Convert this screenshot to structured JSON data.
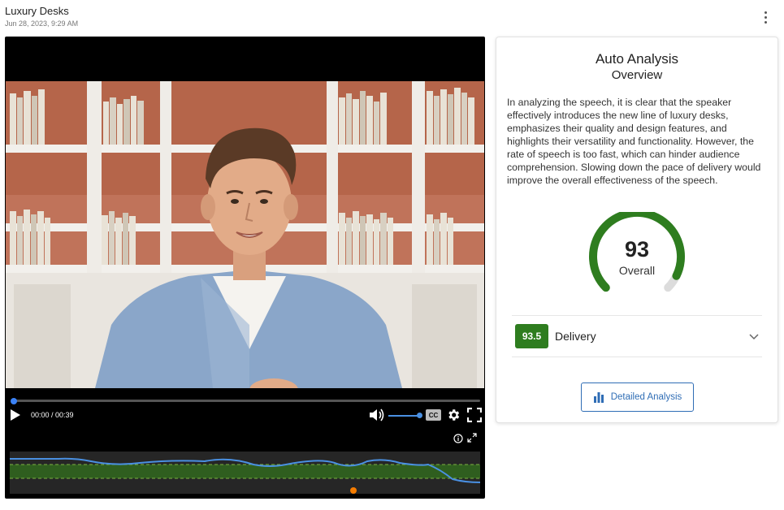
{
  "header": {
    "title": "Luxury Desks",
    "date": "Jun 28, 2023, 9:29 AM",
    "menu_icon": "more-vert-icon"
  },
  "player": {
    "time_display": "00:00 / 00:39",
    "progress": 0.0,
    "volume": 1.0,
    "cc_label": "CC",
    "icons": [
      "play-icon",
      "volume-icon",
      "cc-icon",
      "gear-icon",
      "fullscreen-icon",
      "info-icon",
      "expand-icon"
    ],
    "waveform_colors": {
      "line": "#4a90e2",
      "band": "#2f5e1f",
      "band_edge": "#7cb342",
      "background": "#262626",
      "marker": "#f57c00"
    }
  },
  "analysis": {
    "title": "Auto Analysis",
    "subtitle": "Overview",
    "summary": "In analyzing the speech, it is clear that the speaker effectively introduces the new line of luxury desks, emphasizes their quality and design features, and highlights their versatility and functionality. However, the rate of speech is too fast, which can hinder audience comprehension. Slowing down the pace of delivery would improve the overall effectiveness of the speech.",
    "overall_score": "93",
    "overall_label": "Overall",
    "overall_fraction": 0.93,
    "gauge_color": "#2e7d1f",
    "delivery_score": "93.5",
    "delivery_label": "Delivery",
    "detail_button": "Detailed Analysis"
  }
}
